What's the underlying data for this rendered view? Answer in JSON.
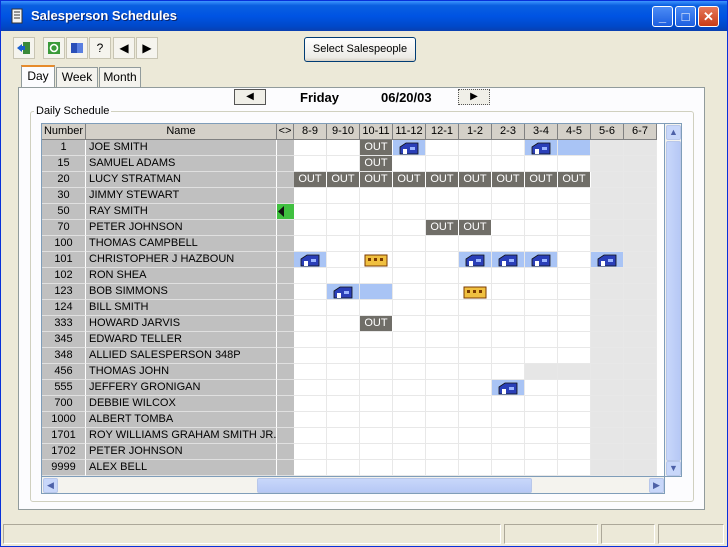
{
  "window": {
    "title": "Salesperson Schedules",
    "minimize": "_",
    "maximize": "□",
    "close": "✕"
  },
  "toolbar": {
    "select_salespeople": "Select Salespeople"
  },
  "tabs": [
    {
      "label": "Day"
    },
    {
      "label": "Week"
    },
    {
      "label": "Month"
    }
  ],
  "nav": {
    "prev": "◀",
    "next": "▶",
    "day": "Friday",
    "date": "06/20/03"
  },
  "group_label": "Daily Schedule",
  "columns": {
    "number": "Number",
    "name": "Name",
    "marker": "<>",
    "slots": [
      "8-9",
      "9-10",
      "10-11",
      "11-12",
      "12-1",
      "1-2",
      "2-3",
      "3-4",
      "4-5",
      "5-6",
      "6-7"
    ]
  },
  "rows": [
    {
      "num": "1",
      "name": "JOE SMITH",
      "marker": false,
      "cells": [
        "",
        "",
        "OUT",
        "H",
        "",
        "",
        "",
        "H",
        "B",
        "L",
        "L"
      ]
    },
    {
      "num": "15",
      "name": "SAMUEL ADAMS",
      "marker": false,
      "cells": [
        "",
        "",
        "OUT",
        "",
        "",
        "",
        "",
        "",
        "",
        "L",
        "L"
      ]
    },
    {
      "num": "20",
      "name": "LUCY STRATMAN",
      "marker": false,
      "cells": [
        "OUT",
        "OUT",
        "OUT",
        "OUT",
        "OUT",
        "OUT",
        "OUT",
        "OUT",
        "OUT",
        "L",
        "L"
      ]
    },
    {
      "num": "30",
      "name": "JIMMY STEWART",
      "marker": false,
      "cells": [
        "",
        "",
        "",
        "",
        "",
        "",
        "",
        "",
        "",
        "L",
        "L"
      ]
    },
    {
      "num": "50",
      "name": "RAY SMITH",
      "marker": true,
      "cells": [
        "",
        "",
        "",
        "",
        "",
        "",
        "",
        "",
        "",
        "L",
        "L"
      ]
    },
    {
      "num": "70",
      "name": "PETER JOHNSON",
      "marker": false,
      "cells": [
        "",
        "",
        "",
        "",
        "OUT",
        "OUT",
        "",
        "",
        "",
        "L",
        "L"
      ]
    },
    {
      "num": "100",
      "name": "THOMAS CAMPBELL",
      "marker": false,
      "cells": [
        "",
        "",
        "",
        "",
        "",
        "",
        "",
        "",
        "",
        "L",
        "L"
      ]
    },
    {
      "num": "101",
      "name": "CHRISTOPHER J HAZBOUN",
      "marker": false,
      "cells": [
        "H",
        "",
        "Y",
        "",
        "",
        "H",
        "H",
        "H",
        "",
        "H",
        "L"
      ]
    },
    {
      "num": "102",
      "name": "RON SHEA",
      "marker": false,
      "cells": [
        "",
        "",
        "",
        "",
        "",
        "",
        "",
        "",
        "",
        "L",
        "L"
      ]
    },
    {
      "num": "123",
      "name": "BOB SIMMONS",
      "marker": false,
      "cells": [
        "",
        "H",
        "B",
        "",
        "",
        "Y",
        "",
        "",
        "",
        "L",
        "L"
      ]
    },
    {
      "num": "124",
      "name": "BILL SMITH",
      "marker": false,
      "cells": [
        "",
        "",
        "",
        "",
        "",
        "",
        "",
        "",
        "",
        "L",
        "L"
      ]
    },
    {
      "num": "333",
      "name": "HOWARD JARVIS",
      "marker": false,
      "cells": [
        "",
        "",
        "OUT",
        "",
        "",
        "",
        "",
        "",
        "",
        "L",
        "L"
      ]
    },
    {
      "num": "345",
      "name": "EDWARD TELLER",
      "marker": false,
      "cells": [
        "",
        "",
        "",
        "",
        "",
        "",
        "",
        "",
        "",
        "L",
        "L"
      ]
    },
    {
      "num": "348",
      "name": "ALLIED SALESPERSON 348P",
      "marker": false,
      "cells": [
        "",
        "",
        "",
        "",
        "",
        "",
        "",
        "",
        "",
        "L",
        "L"
      ]
    },
    {
      "num": "456",
      "name": "THOMAS JOHN",
      "marker": false,
      "cells": [
        "",
        "",
        "",
        "",
        "",
        "",
        "",
        "L",
        "L",
        "L",
        "L"
      ]
    },
    {
      "num": "555",
      "name": "JEFFERY GRONIGAN",
      "marker": false,
      "cells": [
        "",
        "",
        "",
        "",
        "",
        "",
        "H",
        "",
        "",
        "L",
        "L"
      ]
    },
    {
      "num": "700",
      "name": "DEBBIE WILCOX",
      "marker": false,
      "cells": [
        "",
        "",
        "",
        "",
        "",
        "",
        "",
        "",
        "",
        "L",
        "L"
      ]
    },
    {
      "num": "1000",
      "name": "ALBERT TOMBA",
      "marker": false,
      "cells": [
        "",
        "",
        "",
        "",
        "",
        "",
        "",
        "",
        "",
        "L",
        "L"
      ]
    },
    {
      "num": "1701",
      "name": "ROY WILLIAMS GRAHAM SMITH JR.",
      "marker": false,
      "cells": [
        "",
        "",
        "",
        "",
        "",
        "",
        "",
        "",
        "",
        "L",
        "L"
      ]
    },
    {
      "num": "1702",
      "name": "PETER JOHNSON",
      "marker": false,
      "cells": [
        "",
        "",
        "",
        "",
        "",
        "",
        "",
        "",
        "",
        "L",
        "L"
      ]
    },
    {
      "num": "9999",
      "name": "ALEX BELL",
      "marker": false,
      "cells": [
        "",
        "",
        "",
        "",
        "",
        "",
        "",
        "",
        "",
        "L",
        "L"
      ]
    }
  ],
  "colors": {
    "out": "#706e68",
    "blue_slot": "#a9c4f5",
    "late_slot": "#e6e6e6",
    "house_icon": "#2a3fb8",
    "office_icon": "#f0c040",
    "row_header": "#c0c0c0",
    "marker": "#40c040"
  }
}
